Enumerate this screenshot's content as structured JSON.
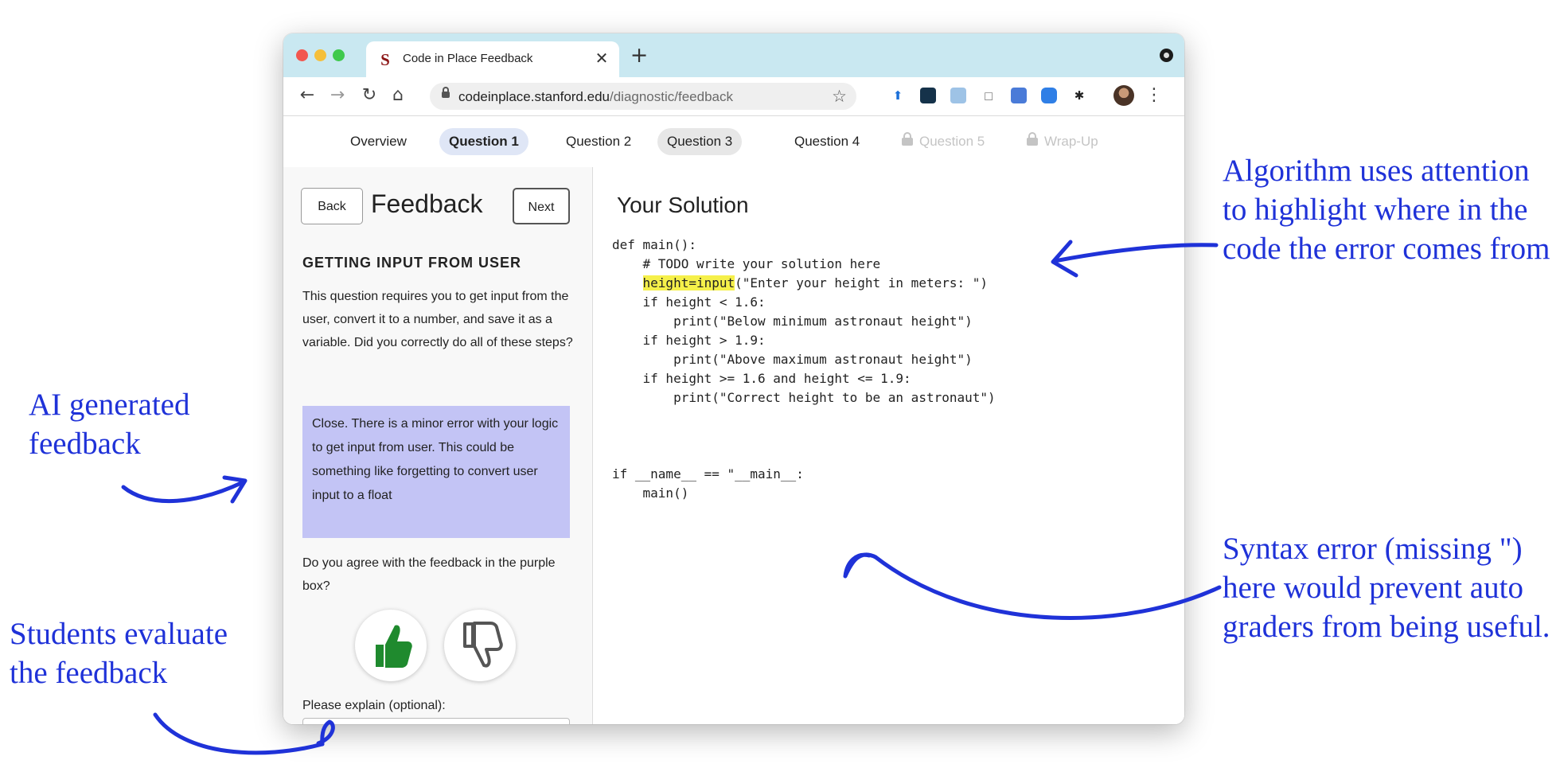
{
  "browser": {
    "tab_title": "Code in Place Feedback",
    "tab_close": "✕",
    "new_tab": "+",
    "url_domain": "codeinplace.stanford.edu",
    "url_path": "/diagnostic/feedback"
  },
  "nav": {
    "overview": "Overview",
    "q1": "Question 1",
    "q2": "Question 2",
    "q3": "Question 3",
    "q4": "Question 4",
    "q5": "Question 5",
    "wrapup": "Wrap-Up"
  },
  "feedback_panel": {
    "back": "Back",
    "title": "Feedback",
    "next": "Next",
    "section_title": "GETTING INPUT FROM USER",
    "section_desc": "This question requires you to get input from the user, convert it to a number, and save it as a variable. Did you correctly do all of these steps?",
    "ai_feedback": "Close. There is a minor error with your logic to get input from user. This could be something like forgetting to convert user input to a float",
    "agree_q": "Do you agree with the feedback in the purple box?",
    "explain_label": "Please explain (optional):"
  },
  "solution": {
    "title": "Your Solution",
    "line1": "def main():",
    "line2": "    # TODO write your solution here",
    "line3_hl": "height=input",
    "line3_rest": "(\"Enter your height in meters: \")",
    "line4": "    if height < 1.6:",
    "line5": "        print(\"Below minimum astronaut height\")",
    "line6": "    if height > 1.9:",
    "line7": "        print(\"Above maximum astronaut height\")",
    "line8": "    if height >= 1.6 and height <= 1.9:",
    "line9": "        print(\"Correct height to be an astronaut\")",
    "line10": "if __name__ == \"__main__:",
    "line11": "    main()"
  },
  "annotations": {
    "algorithm": "Algorithm uses attention to highlight where in the code the error comes from",
    "ai_generated": "AI generated feedback",
    "students": "Students evaluate the feedback",
    "syntax": "Syntax error (missing \") here would prevent auto graders from being useful."
  },
  "colors": {
    "annotation": "#1f32d8",
    "tabbar": "#c9e8f1",
    "purple_box": "#c3c4f5",
    "highlight": "#f5f04a",
    "thumbs_up": "#1f8a2e",
    "stanford_red": "#8c1515"
  }
}
